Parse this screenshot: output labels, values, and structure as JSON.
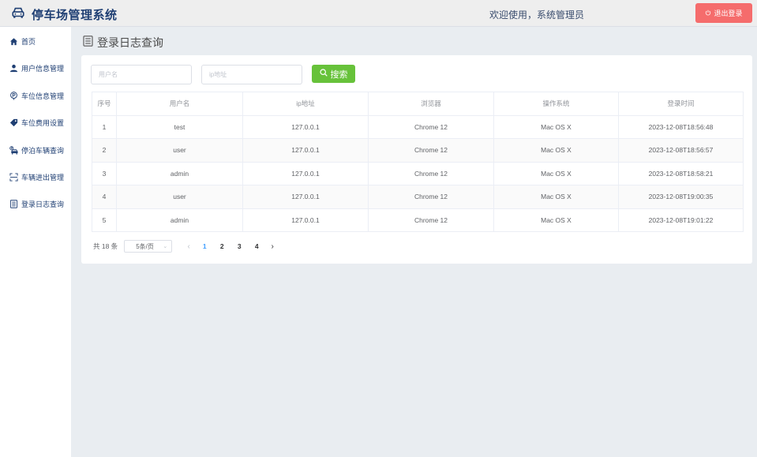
{
  "app": {
    "title": "停车场管理系统",
    "welcome": "欢迎使用，系统管理员",
    "logout_label": "退出登录"
  },
  "sidebar": {
    "items": [
      {
        "label": "首页",
        "icon": "home-icon"
      },
      {
        "label": "用户信息管理",
        "icon": "user-icon"
      },
      {
        "label": "车位信息管理",
        "icon": "parking-icon"
      },
      {
        "label": "车位费用设置",
        "icon": "price-tag-icon"
      },
      {
        "label": "停泊车辆查询",
        "icon": "parked-car-icon"
      },
      {
        "label": "车辆进出管理",
        "icon": "scan-icon"
      },
      {
        "label": "登录日志查询",
        "icon": "log-icon"
      }
    ]
  },
  "page": {
    "title": "登录日志查询"
  },
  "search": {
    "username_placeholder": "用户名",
    "ip_placeholder": "ip地址",
    "button_label": "搜索"
  },
  "table": {
    "headers": [
      "序号",
      "用户名",
      "ip地址",
      "浏览器",
      "操作系统",
      "登录时间"
    ],
    "rows": [
      [
        "1",
        "test",
        "127.0.0.1",
        "Chrome 12",
        "Mac OS X",
        "2023-12-08T18:56:48"
      ],
      [
        "2",
        "user",
        "127.0.0.1",
        "Chrome 12",
        "Mac OS X",
        "2023-12-08T18:56:57"
      ],
      [
        "3",
        "admin",
        "127.0.0.1",
        "Chrome 12",
        "Mac OS X",
        "2023-12-08T18:58:21"
      ],
      [
        "4",
        "user",
        "127.0.0.1",
        "Chrome 12",
        "Mac OS X",
        "2023-12-08T19:00:35"
      ],
      [
        "5",
        "admin",
        "127.0.0.1",
        "Chrome 12",
        "Mac OS X",
        "2023-12-08T19:01:22"
      ]
    ]
  },
  "pagination": {
    "total_label": "共 18 条",
    "page_size_label": "5条/页",
    "pages": [
      "1",
      "2",
      "3",
      "4"
    ],
    "current_page": 1
  },
  "colors": {
    "brand": "#1f3f73",
    "logout": "#f56c6c",
    "search": "#67c23a",
    "active_page": "#409eff"
  }
}
